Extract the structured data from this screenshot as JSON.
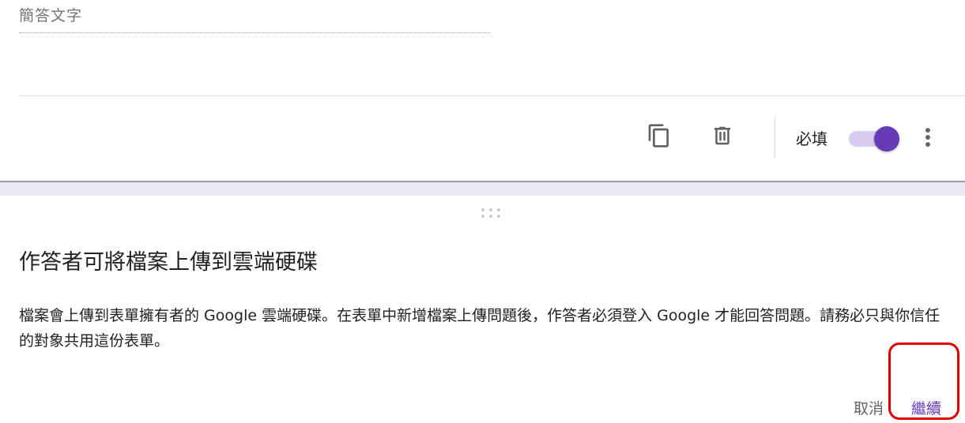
{
  "question": {
    "short_answer_placeholder": "簡答文字",
    "toolbar": {
      "copy_icon": "content-copy-icon",
      "delete_icon": "trash-icon",
      "required_label": "必填",
      "required_on": true,
      "more_icon": "more-vert-icon"
    }
  },
  "dialog": {
    "title": "作答者可將檔案上傳到雲端硬碟",
    "body": "檔案會上傳到表單擁有者的 Google 雲端硬碟。在表單中新增檔案上傳問題後，作答者必須登入 Google 才能回答問題。請務必只與你信任的對象共用這份表單。",
    "cancel_label": "取消",
    "continue_label": "繼續"
  },
  "colors": {
    "accent": "#673ab7",
    "toggle_track": "#d9ccf0",
    "band": "#ece8f6",
    "highlight": "#e00000"
  }
}
